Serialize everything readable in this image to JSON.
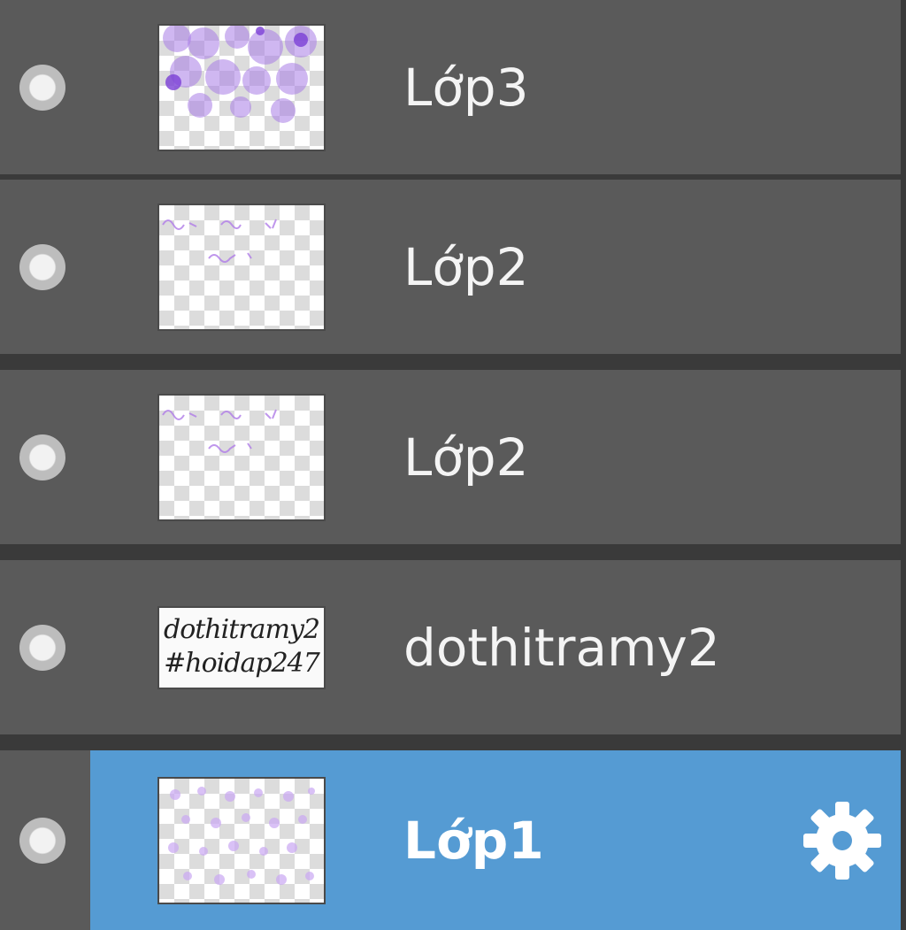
{
  "layers": [
    {
      "label": "Lớp3",
      "thumb_icon": "purple-bokeh-thumbnail",
      "selected": false
    },
    {
      "label": "Lớp2",
      "thumb_icon": "faint-purple-text-thumbnail",
      "selected": false
    },
    {
      "label": "Lớp2",
      "thumb_icon": "faint-purple-text-thumbnail",
      "selected": false
    },
    {
      "label": "dothitramy2",
      "thumb_icon": "black-text-thumbnail",
      "thumb_text": [
        "dothitramy2",
        "#hoidap247"
      ],
      "selected": false
    },
    {
      "label": "Lớp1",
      "thumb_icon": "purple-pattern-thumbnail",
      "selected": true
    }
  ],
  "colors": {
    "row_bg": "#5a5a5a",
    "selected_bg": "#559bd3",
    "separator": "#3a3a3a",
    "label_text": "#f4f4f4"
  }
}
